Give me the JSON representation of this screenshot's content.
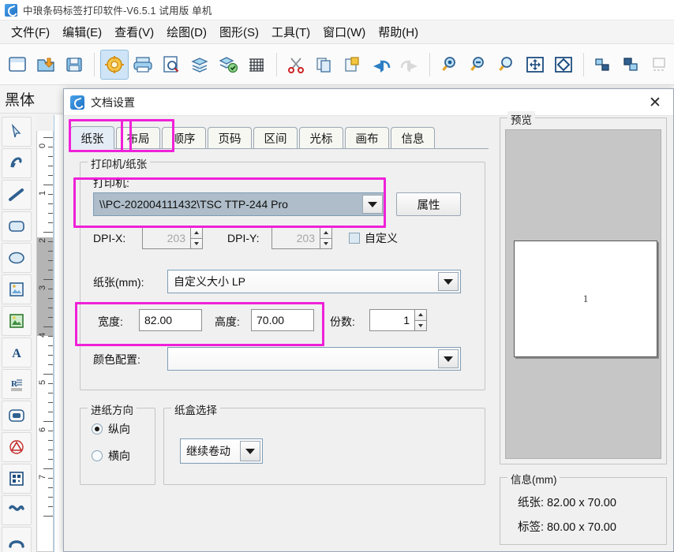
{
  "window": {
    "title": "中琅条码标签打印软件-V6.5.1 试用版 单机",
    "app_icon": "app-logo-icon"
  },
  "menubar": {
    "items": [
      {
        "label": "文件(F)",
        "name": "menu-file"
      },
      {
        "label": "编辑(E)",
        "name": "menu-edit"
      },
      {
        "label": "查看(V)",
        "name": "menu-view"
      },
      {
        "label": "绘图(D)",
        "name": "menu-draw"
      },
      {
        "label": "图形(S)",
        "name": "menu-shape"
      },
      {
        "label": "工具(T)",
        "name": "menu-tools"
      },
      {
        "label": "窗口(W)",
        "name": "menu-window"
      },
      {
        "label": "帮助(H)",
        "name": "menu-help"
      }
    ]
  },
  "toolbar": {
    "icons": [
      "new-document-icon",
      "open-file-icon",
      "save-icon",
      "document-settings-icon",
      "print-icon",
      "print-preview-icon",
      "database-icon",
      "database-connect-icon",
      "grid-icon",
      "cut-icon",
      "copy-icon",
      "paste-icon",
      "undo-icon",
      "redo-icon",
      "zoom-in-icon",
      "zoom-out-icon",
      "zoom-actual-icon",
      "fit-page-icon",
      "fit-width-icon",
      "align-icon",
      "group-icon",
      "layout-icon"
    ]
  },
  "fontbar": {
    "font_name": "黑体"
  },
  "palette": {
    "tools": [
      "select-arrow-icon",
      "node-edit-icon",
      "line-tool-icon",
      "rounded-rect-tool-icon",
      "ellipse-tool-icon",
      "image-tool-icon",
      "picture-tool-icon",
      "text-tool-icon",
      "barcode-tool-icon",
      "filled-rect-tool-icon",
      "triangle-tool-icon",
      "qrcode-tool-icon",
      "curve-tool-icon",
      "arc-tool-icon"
    ]
  },
  "ruler": {
    "marks": [
      "0",
      "1",
      "2",
      "3",
      "4",
      "5",
      "6",
      "7"
    ]
  },
  "dialog": {
    "title": "文档设置",
    "icon": "dialog-logo-icon",
    "close_label": "✕",
    "tabs": [
      {
        "label": "纸张",
        "selected": true
      },
      {
        "label": "布局",
        "selected": false
      },
      {
        "label": "顺序",
        "selected": false
      },
      {
        "label": "页码",
        "selected": false
      },
      {
        "label": "区间",
        "selected": false
      },
      {
        "label": "光标",
        "selected": false
      },
      {
        "label": "画布",
        "selected": false
      },
      {
        "label": "信息",
        "selected": false
      }
    ],
    "printer_group": {
      "legend": "打印机/纸张",
      "printer_label": "打印机:",
      "printer_value": "\\\\PC-202004111432\\TSC TTP-244 Pro",
      "properties_button": "属性",
      "dpix_label": "DPI-X:",
      "dpix_value": "203",
      "dpiy_label": "DPI-Y:",
      "dpiy_value": "203",
      "custom_checkbox": "自定义",
      "paper_label": "纸张(mm):",
      "paper_value": "自定义大小 LP",
      "width_label": "宽度:",
      "width_value": "82.00",
      "height_label": "高度:",
      "height_value": "70.00",
      "copies_label": "份数:",
      "copies_value": "1",
      "color_label": "颜色配置:",
      "color_value": ""
    },
    "feed_group": {
      "legend": "进纸方向",
      "options": [
        {
          "label": "纵向",
          "selected": true
        },
        {
          "label": "横向",
          "selected": false
        }
      ]
    },
    "tray_group": {
      "legend": "纸盒选择",
      "value": "继续卷动"
    },
    "preview_group": {
      "legend": "预览",
      "page_mark": "1"
    },
    "info_group": {
      "legend": "信息(mm)",
      "lines": [
        "纸张: 82.00 x 70.00",
        "标签: 80.00 x 70.00"
      ]
    }
  },
  "highlights": {
    "accent_color": "#ef21d8",
    "regions": [
      "tab-paper",
      "tab-layout",
      "printer-row",
      "size-row"
    ]
  }
}
